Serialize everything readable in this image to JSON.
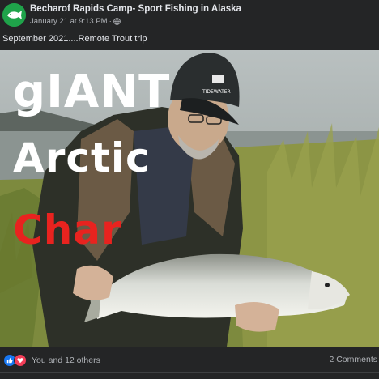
{
  "post": {
    "page_name": "Becharof Rapids Camp- Sport Fishing in Alaska",
    "timestamp": "January 21 at 9:13 PM",
    "separator": "·",
    "privacy_icon": "globe-icon",
    "caption": "September 2021....Remote Trout trip"
  },
  "photo": {
    "line1": "gIANT",
    "line2": "Arctic",
    "line3": "Char",
    "cap_logo": "TIDEWATER",
    "colors": {
      "line1": "#ffffff",
      "line2": "#ffffff",
      "line3": "#e8231f"
    }
  },
  "footer": {
    "reaction_icons": [
      "like-icon",
      "love-icon"
    ],
    "reactions_text": "You and 12 others",
    "comments_text": "2 Comments"
  }
}
